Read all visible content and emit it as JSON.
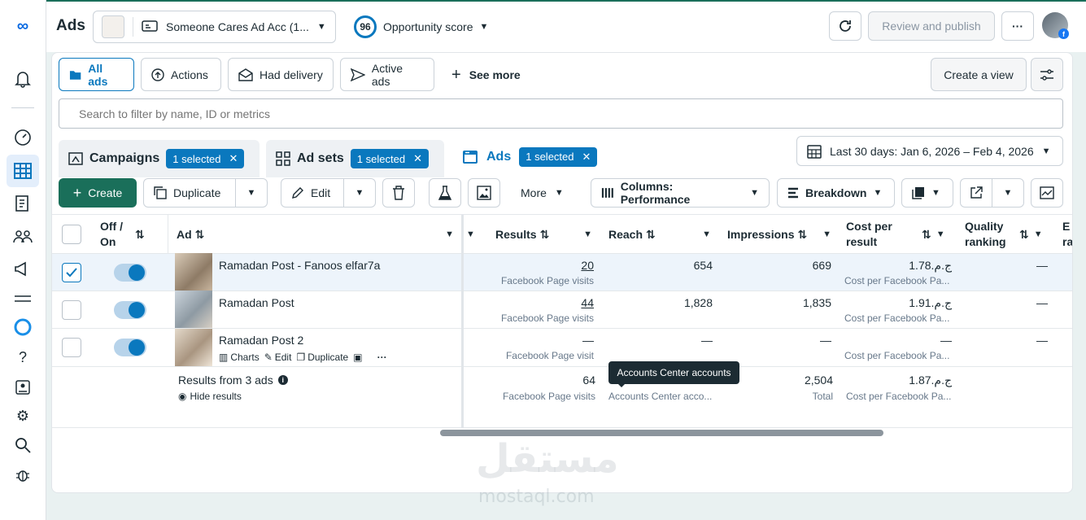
{
  "sidebar": {
    "icons": [
      "meta-logo-icon",
      "bell-icon",
      "dashboard-icon",
      "table-grid-icon",
      "catalog-icon",
      "audience-icon",
      "megaphone-icon",
      "menu-lines-icon",
      "meta-ai-ring-icon",
      "help-icon",
      "id-card-icon",
      "gear-icon",
      "search-icon",
      "bug-icon"
    ]
  },
  "header": {
    "title": "Ads",
    "account_name": "Someone Cares Ad Acc (1...",
    "score_value": "96",
    "score_label": "Opportunity score",
    "review_label": "Review and publish"
  },
  "filters": {
    "all_ads": "All ads",
    "actions": "Actions",
    "had_delivery": "Had delivery",
    "active_ads": "Active ads",
    "see_more": "See more",
    "create_view": "Create a view",
    "search_placeholder": "Search to filter by name, ID or metrics"
  },
  "tabs": {
    "campaigns": "Campaigns",
    "campaigns_badge": "1 selected",
    "adsets": "Ad sets",
    "adsets_badge": "1 selected",
    "ads": "Ads",
    "ads_badge": "1 selected",
    "date_range": "Last 30 days: Jan 6, 2026 – Feb 4, 2026"
  },
  "toolbar": {
    "create": "Create",
    "duplicate": "Duplicate",
    "edit": "Edit",
    "more": "More",
    "columns": "Columns: Performance",
    "breakdown": "Breakdown"
  },
  "table": {
    "headers": {
      "offon_1": "Off /",
      "offon_2": "On",
      "ad": "Ad",
      "results": "Results",
      "reach": "Reach",
      "impressions": "Impressions",
      "cost_1": "Cost per",
      "cost_2": "result",
      "quality_1": "Quality",
      "quality_2": "ranking",
      "next_1": "E",
      "next_2": "ra"
    },
    "rows": [
      {
        "name": "Ramadan Post - Fanoos elfar7a",
        "results": "20",
        "results_sub": "Facebook Page visits",
        "reach": "654",
        "impressions": "669",
        "cost": "ج.م.1.78",
        "cost_sub": "Cost per Facebook Pa...",
        "quality": "—"
      },
      {
        "name": "Ramadan Post",
        "results": "44",
        "results_sub": "Facebook Page visits",
        "reach": "1,828",
        "impressions": "1,835",
        "cost": "ج.م.1.91",
        "cost_sub": "Cost per Facebook Pa...",
        "quality": "—"
      },
      {
        "name": "Ramadan Post 2",
        "results": "—",
        "results_sub": "Facebook Page visit",
        "reach": "—",
        "impressions": "—",
        "cost": "—",
        "cost_sub": "Cost per Facebook Pa...",
        "quality": "—",
        "actions": {
          "charts": "Charts",
          "edit": "Edit",
          "duplicate": "Duplicate"
        }
      }
    ],
    "summary": {
      "label": "Results from 3 ads",
      "hide": "Hide results",
      "results": "64",
      "results_sub": "Facebook Page visits",
      "reach_sub": "Accounts Center acco...",
      "impressions": "2,504",
      "impressions_sub": "Total",
      "cost": "ج.م.1.87",
      "cost_sub": "Cost per Facebook Pa..."
    },
    "tooltip": "Accounts Center accounts"
  },
  "watermark": {
    "arabic": "مستقل",
    "latin": "mostaql.com"
  }
}
